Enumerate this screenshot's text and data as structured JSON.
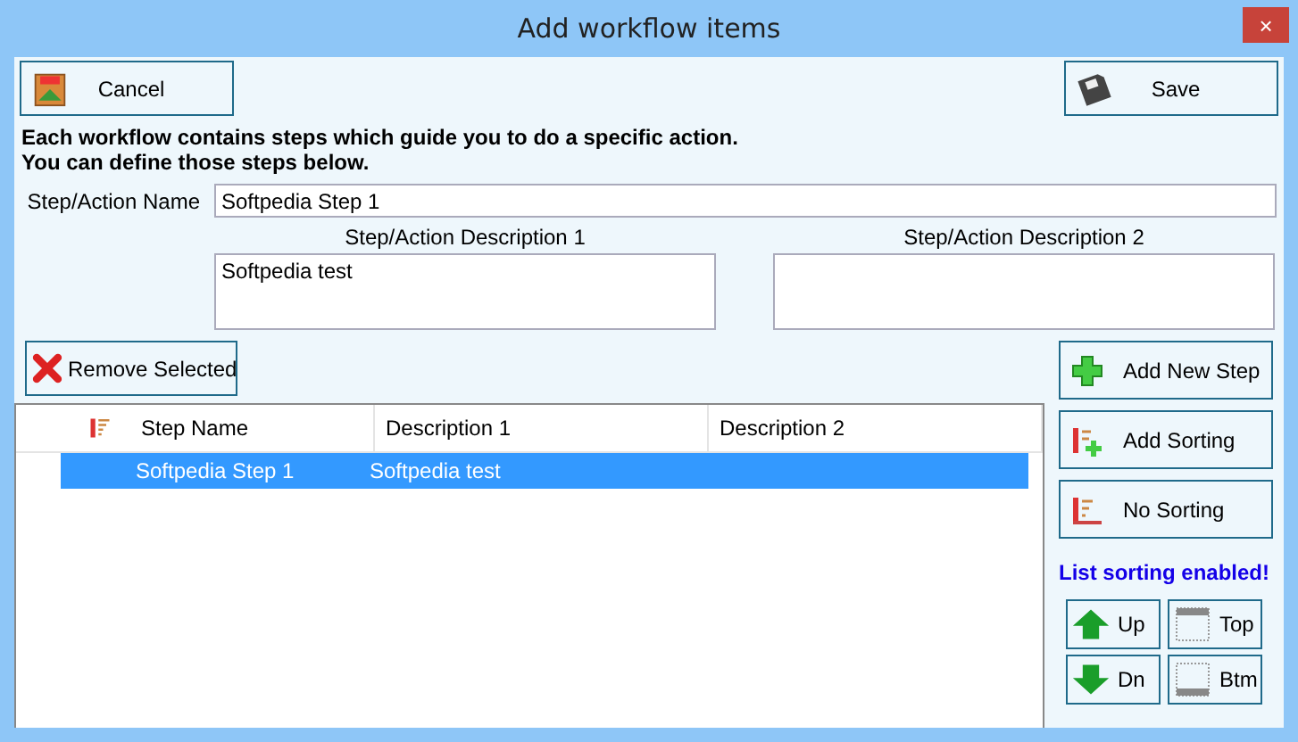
{
  "window": {
    "title": "Add workflow items",
    "close": "×"
  },
  "toolbar": {
    "cancel": "Cancel",
    "save": "Save"
  },
  "intro": [
    "Each workflow contains steps which guide you to do a specific action.",
    "You can define those steps below."
  ],
  "form": {
    "name_label": "Step/Action Name",
    "name_value": "Softpedia Step 1",
    "desc1_label": "Step/Action Description 1",
    "desc1_value": "Softpedia test",
    "desc2_label": "Step/Action Description 2"
  },
  "remove_button": "Remove Selected",
  "table": {
    "columns": [
      "Step Name",
      "Description 1",
      "Description 2"
    ],
    "rows": [
      {
        "cells": [
          "Softpedia Step 1",
          "Softpedia test"
        ],
        "selected": true
      }
    ]
  },
  "side": {
    "add_step": "Add New Step",
    "add_sorting": "Add Sorting",
    "no_sorting": "No Sorting",
    "status": "List sorting enabled!",
    "up": "Up",
    "top": "Top",
    "down": "Dn",
    "bottom": "Btm"
  }
}
